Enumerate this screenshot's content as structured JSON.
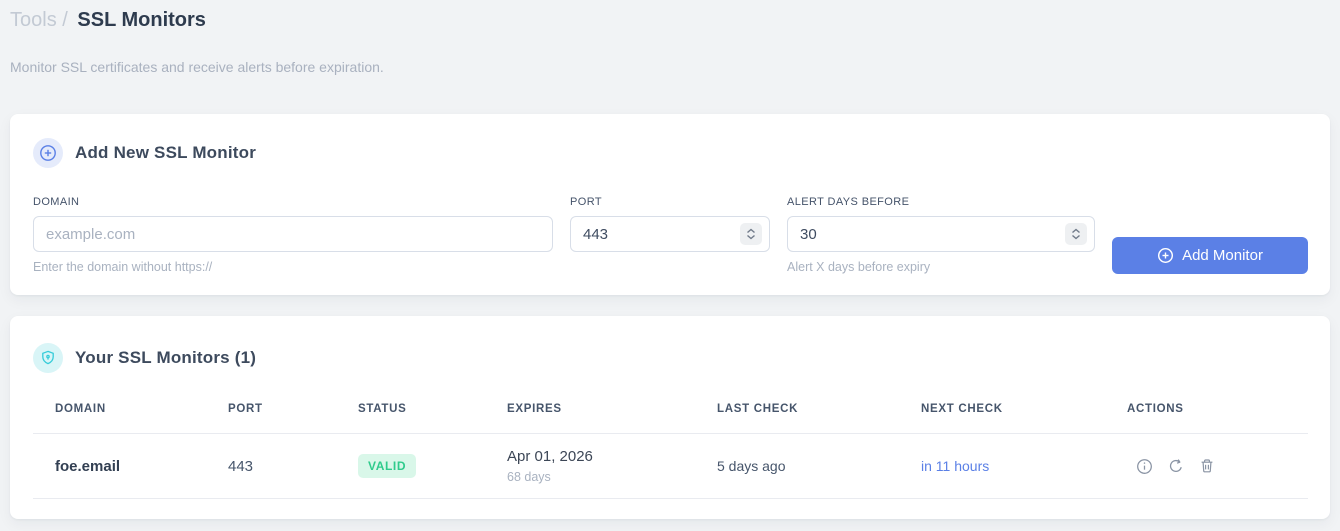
{
  "breadcrumb": {
    "section": "Tools",
    "separator": "/",
    "current": "SSL Monitors"
  },
  "subtitle": "Monitor SSL certificates and receive alerts before expiration.",
  "add_monitor_card": {
    "title": "Add New SSL Monitor",
    "icon": "plus-circle-icon",
    "fields": {
      "domain": {
        "label": "DOMAIN",
        "placeholder": "example.com",
        "helper": "Enter the domain without https://"
      },
      "port": {
        "label": "PORT",
        "value": "443"
      },
      "alert_days": {
        "label": "ALERT DAYS BEFORE",
        "value": "30",
        "helper": "Alert X days before expiry"
      }
    },
    "submit_label": "Add Monitor"
  },
  "monitors_card": {
    "title": "Your SSL Monitors (1)",
    "icon": "shield-lock-icon",
    "table": {
      "columns": [
        "DOMAIN",
        "PORT",
        "STATUS",
        "EXPIRES",
        "LAST CHECK",
        "NEXT CHECK",
        "ACTIONS"
      ],
      "rows": [
        {
          "domain": "foe.email",
          "port": "443",
          "status": "VALID",
          "expires_date": "Apr 01, 2026",
          "expires_days": "68 days",
          "last_check": "5 days ago",
          "next_check": "in 11 hours",
          "actions": [
            "info-icon",
            "refresh-icon",
            "trash-icon"
          ]
        }
      ]
    }
  },
  "colors": {
    "accent_blue": "#5b80e6",
    "valid_text": "#2fcb8c",
    "valid_bg": "#d9f7e9",
    "teal": "#35ccd9",
    "page_bg": "#f1f3f5"
  }
}
